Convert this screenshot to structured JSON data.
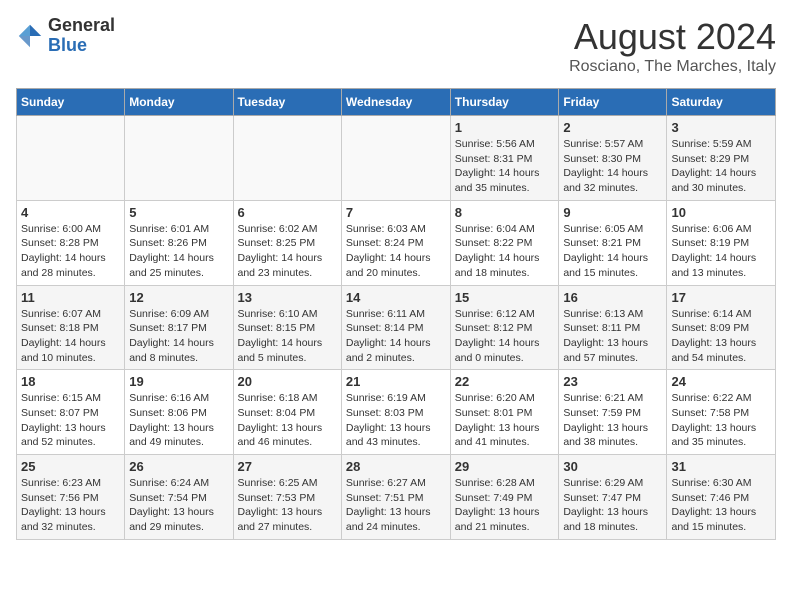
{
  "logo": {
    "general": "General",
    "blue": "Blue"
  },
  "title": {
    "month_year": "August 2024",
    "location": "Rosciano, The Marches, Italy"
  },
  "weekdays": [
    "Sunday",
    "Monday",
    "Tuesday",
    "Wednesday",
    "Thursday",
    "Friday",
    "Saturday"
  ],
  "weeks": [
    [
      {
        "day": "",
        "info": ""
      },
      {
        "day": "",
        "info": ""
      },
      {
        "day": "",
        "info": ""
      },
      {
        "day": "",
        "info": ""
      },
      {
        "day": "1",
        "info": "Sunrise: 5:56 AM\nSunset: 8:31 PM\nDaylight: 14 hours and 35 minutes."
      },
      {
        "day": "2",
        "info": "Sunrise: 5:57 AM\nSunset: 8:30 PM\nDaylight: 14 hours and 32 minutes."
      },
      {
        "day": "3",
        "info": "Sunrise: 5:59 AM\nSunset: 8:29 PM\nDaylight: 14 hours and 30 minutes."
      }
    ],
    [
      {
        "day": "4",
        "info": "Sunrise: 6:00 AM\nSunset: 8:28 PM\nDaylight: 14 hours and 28 minutes."
      },
      {
        "day": "5",
        "info": "Sunrise: 6:01 AM\nSunset: 8:26 PM\nDaylight: 14 hours and 25 minutes."
      },
      {
        "day": "6",
        "info": "Sunrise: 6:02 AM\nSunset: 8:25 PM\nDaylight: 14 hours and 23 minutes."
      },
      {
        "day": "7",
        "info": "Sunrise: 6:03 AM\nSunset: 8:24 PM\nDaylight: 14 hours and 20 minutes."
      },
      {
        "day": "8",
        "info": "Sunrise: 6:04 AM\nSunset: 8:22 PM\nDaylight: 14 hours and 18 minutes."
      },
      {
        "day": "9",
        "info": "Sunrise: 6:05 AM\nSunset: 8:21 PM\nDaylight: 14 hours and 15 minutes."
      },
      {
        "day": "10",
        "info": "Sunrise: 6:06 AM\nSunset: 8:19 PM\nDaylight: 14 hours and 13 minutes."
      }
    ],
    [
      {
        "day": "11",
        "info": "Sunrise: 6:07 AM\nSunset: 8:18 PM\nDaylight: 14 hours and 10 minutes."
      },
      {
        "day": "12",
        "info": "Sunrise: 6:09 AM\nSunset: 8:17 PM\nDaylight: 14 hours and 8 minutes."
      },
      {
        "day": "13",
        "info": "Sunrise: 6:10 AM\nSunset: 8:15 PM\nDaylight: 14 hours and 5 minutes."
      },
      {
        "day": "14",
        "info": "Sunrise: 6:11 AM\nSunset: 8:14 PM\nDaylight: 14 hours and 2 minutes."
      },
      {
        "day": "15",
        "info": "Sunrise: 6:12 AM\nSunset: 8:12 PM\nDaylight: 14 hours and 0 minutes."
      },
      {
        "day": "16",
        "info": "Sunrise: 6:13 AM\nSunset: 8:11 PM\nDaylight: 13 hours and 57 minutes."
      },
      {
        "day": "17",
        "info": "Sunrise: 6:14 AM\nSunset: 8:09 PM\nDaylight: 13 hours and 54 minutes."
      }
    ],
    [
      {
        "day": "18",
        "info": "Sunrise: 6:15 AM\nSunset: 8:07 PM\nDaylight: 13 hours and 52 minutes."
      },
      {
        "day": "19",
        "info": "Sunrise: 6:16 AM\nSunset: 8:06 PM\nDaylight: 13 hours and 49 minutes."
      },
      {
        "day": "20",
        "info": "Sunrise: 6:18 AM\nSunset: 8:04 PM\nDaylight: 13 hours and 46 minutes."
      },
      {
        "day": "21",
        "info": "Sunrise: 6:19 AM\nSunset: 8:03 PM\nDaylight: 13 hours and 43 minutes."
      },
      {
        "day": "22",
        "info": "Sunrise: 6:20 AM\nSunset: 8:01 PM\nDaylight: 13 hours and 41 minutes."
      },
      {
        "day": "23",
        "info": "Sunrise: 6:21 AM\nSunset: 7:59 PM\nDaylight: 13 hours and 38 minutes."
      },
      {
        "day": "24",
        "info": "Sunrise: 6:22 AM\nSunset: 7:58 PM\nDaylight: 13 hours and 35 minutes."
      }
    ],
    [
      {
        "day": "25",
        "info": "Sunrise: 6:23 AM\nSunset: 7:56 PM\nDaylight: 13 hours and 32 minutes."
      },
      {
        "day": "26",
        "info": "Sunrise: 6:24 AM\nSunset: 7:54 PM\nDaylight: 13 hours and 29 minutes."
      },
      {
        "day": "27",
        "info": "Sunrise: 6:25 AM\nSunset: 7:53 PM\nDaylight: 13 hours and 27 minutes."
      },
      {
        "day": "28",
        "info": "Sunrise: 6:27 AM\nSunset: 7:51 PM\nDaylight: 13 hours and 24 minutes."
      },
      {
        "day": "29",
        "info": "Sunrise: 6:28 AM\nSunset: 7:49 PM\nDaylight: 13 hours and 21 minutes."
      },
      {
        "day": "30",
        "info": "Sunrise: 6:29 AM\nSunset: 7:47 PM\nDaylight: 13 hours and 18 minutes."
      },
      {
        "day": "31",
        "info": "Sunrise: 6:30 AM\nSunset: 7:46 PM\nDaylight: 13 hours and 15 minutes."
      }
    ]
  ]
}
